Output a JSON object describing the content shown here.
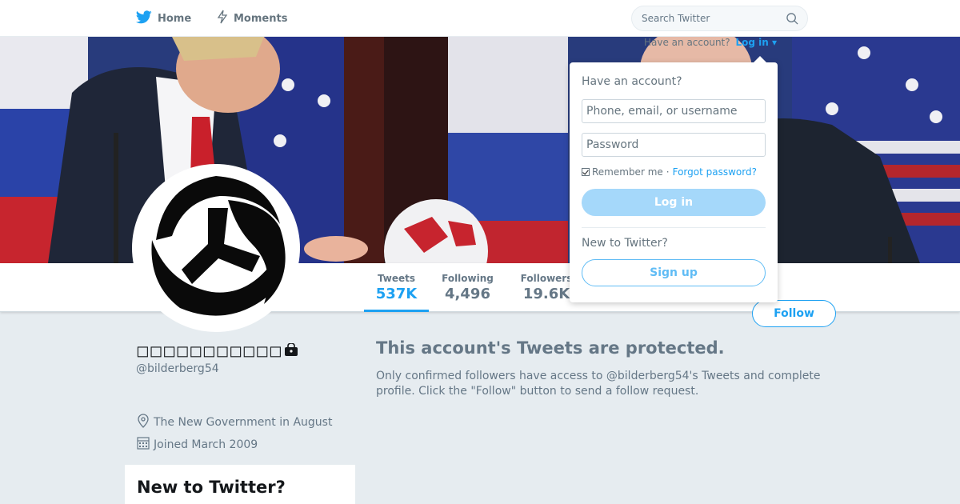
{
  "nav": {
    "home_label": "Home",
    "moments_label": "Moments",
    "search_placeholder": "Search Twitter",
    "have_account_text": "Have an account?",
    "login_link": "Log in ▾"
  },
  "profile": {
    "name": "◻◻◻◻◻◻◻◻◻◻◻",
    "handle": "@bilderberg54",
    "location": "The New Government in August",
    "joined": "Joined March 2009"
  },
  "stats": [
    {
      "label": "Tweets",
      "value": "537K"
    },
    {
      "label": "Following",
      "value": "4,496"
    },
    {
      "label": "Followers",
      "value": "19.6K"
    }
  ],
  "follow_label": "Follow",
  "protected": {
    "title": "This account's Tweets are protected.",
    "text": "Only confirmed followers have access to @bilderberg54's Tweets and complete profile. Click the \"Follow\" button to send a follow request."
  },
  "sidebar_box": {
    "title": "New to Twitter?"
  },
  "login_dropdown": {
    "heading": "Have an account?",
    "username_placeholder": "Phone, email, or username",
    "password_placeholder": "Password",
    "remember_label": "Remember me",
    "separator": "·",
    "forgot_label": "Forgot password?",
    "login_button": "Log in",
    "new_heading": "New to Twitter?",
    "signup_button": "Sign up"
  },
  "colors": {
    "accent": "#1da1f2",
    "text_secondary": "#657786",
    "page_bg": "#e6ecf0"
  },
  "icons": [
    "twitter-bird-icon",
    "moments-bolt-icon",
    "search-icon",
    "lock-icon",
    "location-pin-icon",
    "calendar-icon"
  ]
}
